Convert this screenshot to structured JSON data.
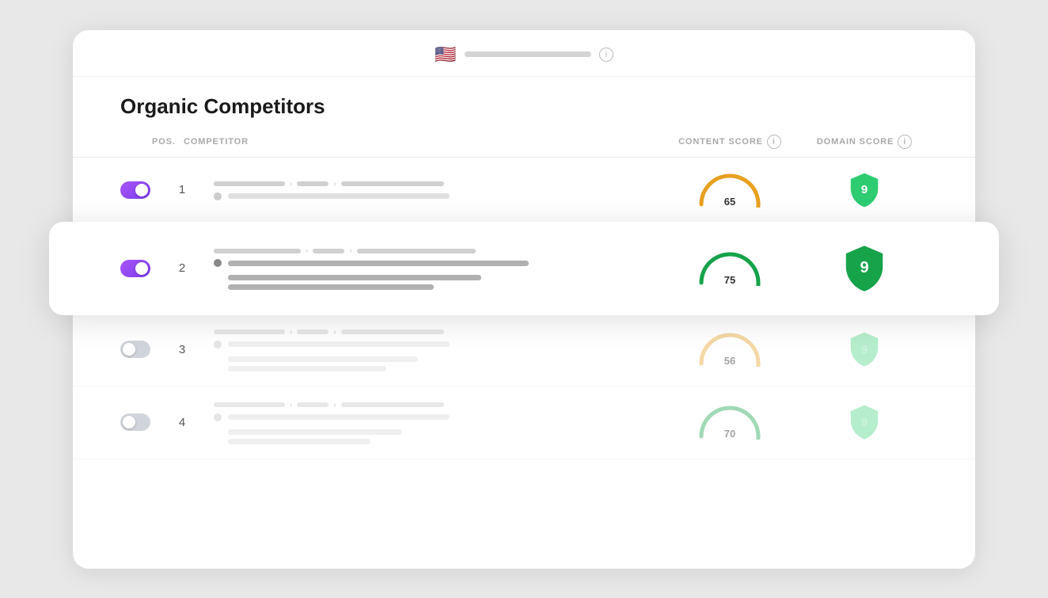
{
  "page": {
    "top_bar": {
      "flag": "🇺🇸",
      "info_label": "i"
    },
    "section_title": "Organic Competitors",
    "table_header": {
      "pos": "POS.",
      "competitor": "COMPETITOR",
      "content_score": "CONTENT SCORE",
      "domain_score": "DOMAIN SCORE"
    },
    "rows": [
      {
        "id": 1,
        "toggle_on": true,
        "pos": "1",
        "content_score": 65,
        "gauge_color_start": "#f5c842",
        "gauge_color_end": "#e8a020",
        "domain_score": 9,
        "shield_color": "#2ecc71",
        "highlighted": false,
        "faded": false
      },
      {
        "id": 2,
        "toggle_on": true,
        "pos": "2",
        "content_score": 75,
        "gauge_color_start": "#22c55e",
        "gauge_color_end": "#16a34a",
        "domain_score": 9,
        "shield_color": "#16a34a",
        "highlighted": true,
        "faded": false
      },
      {
        "id": 3,
        "toggle_on": false,
        "pos": "3",
        "content_score": 56,
        "gauge_color_start": "#f5c842",
        "gauge_color_end": "#e8a020",
        "domain_score": 9,
        "shield_color": "#2ecc71",
        "highlighted": false,
        "faded": true
      },
      {
        "id": 4,
        "toggle_on": false,
        "pos": "4",
        "content_score": 70,
        "gauge_color_start": "#22c55e",
        "gauge_color_end": "#16a34a",
        "domain_score": 9,
        "shield_color": "#2ecc71",
        "highlighted": false,
        "faded": true
      }
    ]
  }
}
